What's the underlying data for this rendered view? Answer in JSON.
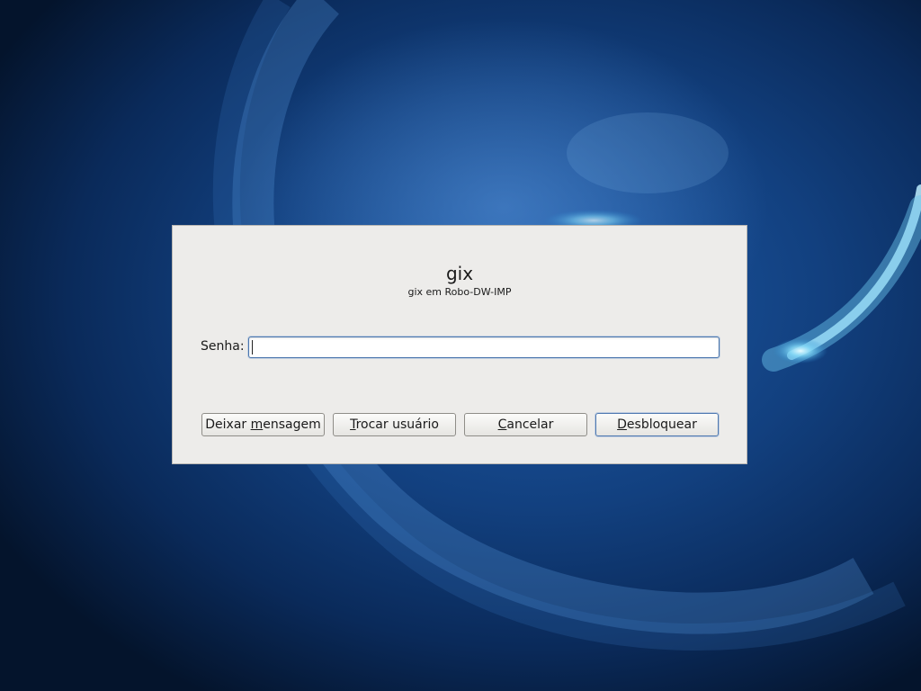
{
  "dialog": {
    "user_name": "gix",
    "subtitle": "gix em Robo-DW-IMP",
    "password_label": "Senha:",
    "password_value": ""
  },
  "buttons": {
    "leave_message": {
      "before": "Deixar ",
      "mnemonic": "m",
      "after": "ensagem"
    },
    "switch_user": {
      "before": "",
      "mnemonic": "T",
      "after": "rocar usuário"
    },
    "cancel": {
      "before": "",
      "mnemonic": "C",
      "after": "ancelar"
    },
    "unlock": {
      "before": "",
      "mnemonic": "D",
      "after": "esbloquear"
    }
  },
  "colors": {
    "dialog_background": "#edecea",
    "focus_border": "#4a76ae",
    "wallpaper_primary": "#12407f"
  }
}
